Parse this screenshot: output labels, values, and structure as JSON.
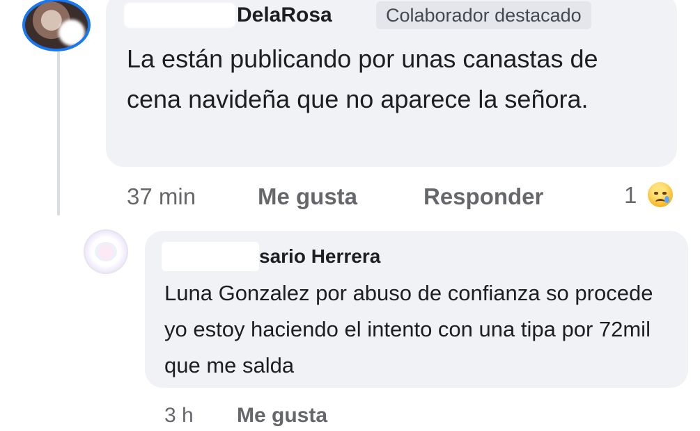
{
  "comment": {
    "author_name": "DelaRosa",
    "badge": "Colaborador destacado",
    "text": "La están publicando por unas canastas de cena navideña que no aparece la señora.",
    "time": "37 min",
    "like_label": "Me gusta",
    "reply_label": "Responder",
    "reaction_count": "1",
    "reaction_icon": "sad-tear-emoji"
  },
  "reply": {
    "author_name": "sario Herrera",
    "text": "Luna Gonzalez por abuso de confianza so procede yo estoy haciendo el intento con una tipa por 72mil que me salda",
    "time": "3 h",
    "like_label": "Me gusta"
  },
  "colors": {
    "bubble_bg": "#f0f2f5",
    "secondary_text": "#65676b",
    "accent": "#1877f2"
  }
}
